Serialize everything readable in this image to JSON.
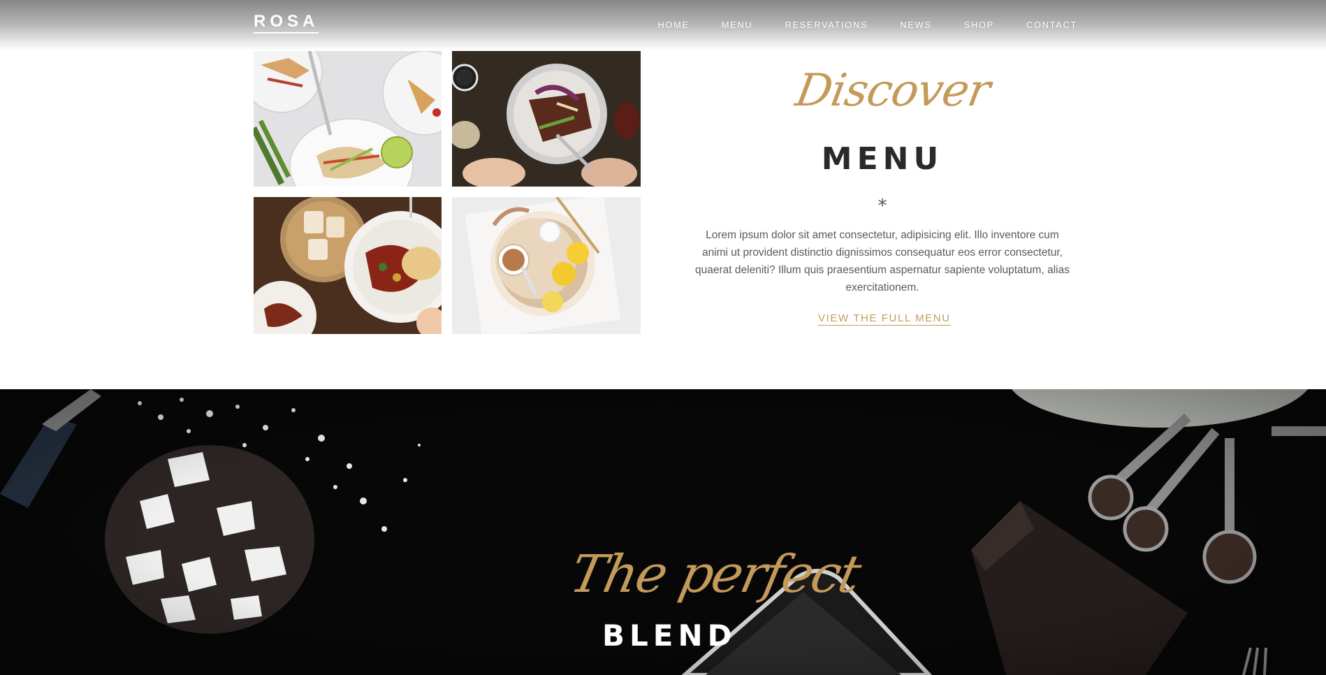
{
  "header": {
    "logo": "ROSA",
    "nav": [
      "HOME",
      "MENU",
      "RESERVATIONS",
      "NEWS",
      "SHOP",
      "CONTACT"
    ]
  },
  "menu_section": {
    "script_title": "Discover",
    "heading": "MENU",
    "divider": "*",
    "description": "Lorem ipsum dolor sit amet consectetur, adipisicing elit. Illo inventore cum animi ut provident distinctio dignissimos consequatur eos error consectetur, quaerat deleniti? Illum quis praesentium aspernatur sapiente voluptatum, alias exercitationem.",
    "link_label": "VIEW THE FULL MENU"
  },
  "blend_section": {
    "script_title": "The perfect",
    "heading": "BLEND"
  },
  "colors": {
    "accent": "#c49a5a",
    "heading": "#2a2a2a",
    "dark_band": "#070707"
  }
}
